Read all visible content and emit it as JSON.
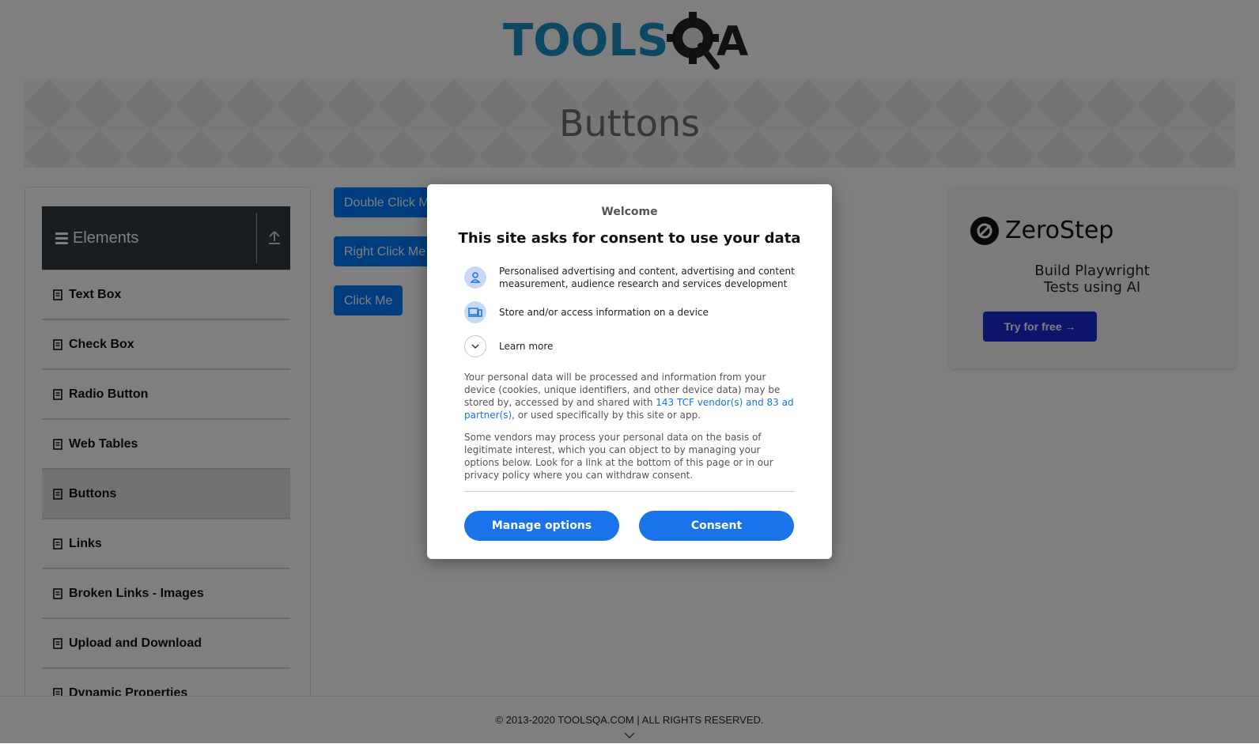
{
  "header": {
    "logo_alt": "TOOLSQA",
    "logo_text_left": "TOOLS",
    "logo_text_right": "A"
  },
  "banner": {
    "title": "Buttons"
  },
  "sidebar": {
    "group_title": "Elements",
    "items": [
      {
        "label": "Text Box"
      },
      {
        "label": "Check Box"
      },
      {
        "label": "Radio Button"
      },
      {
        "label": "Web Tables"
      },
      {
        "label": "Buttons",
        "active": true
      },
      {
        "label": "Links"
      },
      {
        "label": "Broken Links - Images"
      },
      {
        "label": "Upload and Download"
      },
      {
        "label": "Dynamic Properties"
      }
    ]
  },
  "main": {
    "double_click_label": "Double Click Me",
    "right_click_label": "Right Click Me",
    "click_label": "Click Me"
  },
  "ad": {
    "brand": "ZeroStep",
    "tagline_line1": "Build Playwright",
    "tagline_line2": "Tests using AI",
    "cta": "Try for free →"
  },
  "footer": {
    "copyright": "© 2013-2020 TOOLSQA.COM | ALL RIGHTS RESERVED."
  },
  "consent": {
    "welcome": "Welcome",
    "heading": "This site asks for consent to use your data",
    "purpose_ads": "Personalised advertising and content, advertising and content measurement, audience research and services development",
    "purpose_device": "Store and/or access information on a device",
    "learn_more": "Learn more",
    "para1_before": "Your personal data will be processed and information from your device (cookies, unique identifiers, and other device data) may be stored by, accessed by and shared with ",
    "para1_link": "143 TCF vendor(s) and 83 ad partner(s)",
    "para1_after": ", or used specifically by this site or app.",
    "para2": "Some vendors may process your personal data on the basis of legitimate interest, which you can object to by managing your options below. Look for a link at the bottom of this page or in our privacy policy where you can withdraw consent.",
    "manage_label": "Manage options",
    "consent_label": "Consent"
  },
  "colors": {
    "primary": "#007bff",
    "consent_blue": "#1a73e8",
    "sidebar_header": "#343a40",
    "logo_blue": "#1b8fc5",
    "overlay": "rgba(0,0,0,0.5)"
  }
}
